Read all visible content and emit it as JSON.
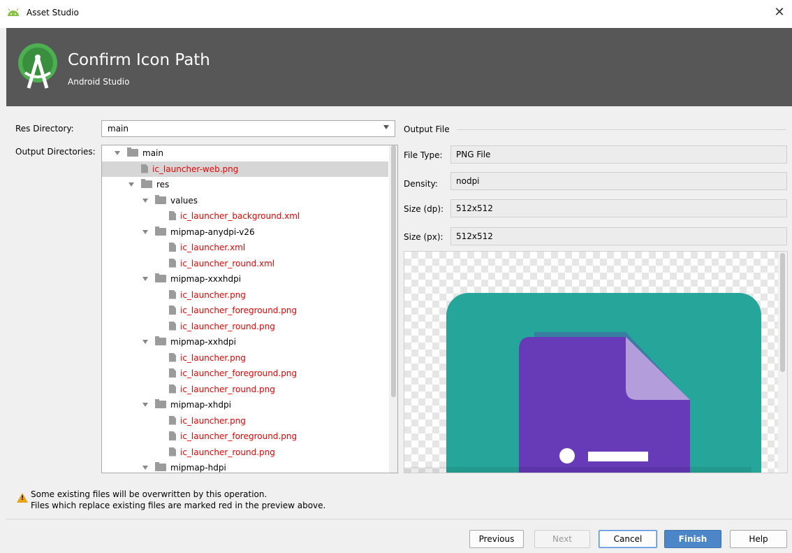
{
  "window": {
    "title": "Asset Studio",
    "close_glyph": "✕"
  },
  "banner": {
    "heading": "Confirm Icon Path",
    "subtitle": "Android Studio"
  },
  "form": {
    "res_directory_label": "Res Directory:",
    "res_directory_value": "main",
    "output_directories_label": "Output Directories:"
  },
  "tree": [
    {
      "label": "main",
      "kind": "folder",
      "level": 0,
      "red": false,
      "selected": false
    },
    {
      "label": "ic_launcher-web.png",
      "kind": "file",
      "level": 1,
      "red": true,
      "selected": true
    },
    {
      "label": "res",
      "kind": "folder",
      "level": 1,
      "red": false,
      "selected": false
    },
    {
      "label": "values",
      "kind": "folder",
      "level": 2,
      "red": false,
      "selected": false
    },
    {
      "label": "ic_launcher_background.xml",
      "kind": "file",
      "level": 3,
      "red": true,
      "selected": false
    },
    {
      "label": "mipmap-anydpi-v26",
      "kind": "folder",
      "level": 2,
      "red": false,
      "selected": false
    },
    {
      "label": "ic_launcher.xml",
      "kind": "file",
      "level": 3,
      "red": true,
      "selected": false
    },
    {
      "label": "ic_launcher_round.xml",
      "kind": "file",
      "level": 3,
      "red": true,
      "selected": false
    },
    {
      "label": "mipmap-xxxhdpi",
      "kind": "folder",
      "level": 2,
      "red": false,
      "selected": false
    },
    {
      "label": "ic_launcher.png",
      "kind": "file",
      "level": 3,
      "red": true,
      "selected": false
    },
    {
      "label": "ic_launcher_foreground.png",
      "kind": "file",
      "level": 3,
      "red": true,
      "selected": false
    },
    {
      "label": "ic_launcher_round.png",
      "kind": "file",
      "level": 3,
      "red": true,
      "selected": false
    },
    {
      "label": "mipmap-xxhdpi",
      "kind": "folder",
      "level": 2,
      "red": false,
      "selected": false
    },
    {
      "label": "ic_launcher.png",
      "kind": "file",
      "level": 3,
      "red": true,
      "selected": false
    },
    {
      "label": "ic_launcher_foreground.png",
      "kind": "file",
      "level": 3,
      "red": true,
      "selected": false
    },
    {
      "label": "ic_launcher_round.png",
      "kind": "file",
      "level": 3,
      "red": true,
      "selected": false
    },
    {
      "label": "mipmap-xhdpi",
      "kind": "folder",
      "level": 2,
      "red": false,
      "selected": false
    },
    {
      "label": "ic_launcher.png",
      "kind": "file",
      "level": 3,
      "red": true,
      "selected": false
    },
    {
      "label": "ic_launcher_foreground.png",
      "kind": "file",
      "level": 3,
      "red": true,
      "selected": false
    },
    {
      "label": "ic_launcher_round.png",
      "kind": "file",
      "level": 3,
      "red": true,
      "selected": false
    },
    {
      "label": "mipmap-hdpi",
      "kind": "folder",
      "level": 2,
      "red": false,
      "selected": false
    }
  ],
  "output_file": {
    "group_label": "Output File",
    "file_type_label": "File Type:",
    "file_type_value": "PNG File",
    "density_label": "Density:",
    "density_value": "nodpi",
    "size_dp_label": "Size (dp):",
    "size_dp_value": "512x512",
    "size_px_label": "Size (px):",
    "size_px_value": "512x512"
  },
  "warning": {
    "line1": "Some existing files will be overwritten by this operation.",
    "line2": "Files which replace existing files are marked red in the preview above."
  },
  "buttons": {
    "previous": "Previous",
    "next": "Next",
    "cancel": "Cancel",
    "finish": "Finish",
    "help": "Help"
  },
  "colors": {
    "banner_bg": "#575757",
    "overwrite_red": "#ee0000",
    "icon_teal": "#26a69a",
    "icon_purple": "#673ab7",
    "finish_blue": "#4a86c8",
    "warning_amber": "#e8a317"
  }
}
